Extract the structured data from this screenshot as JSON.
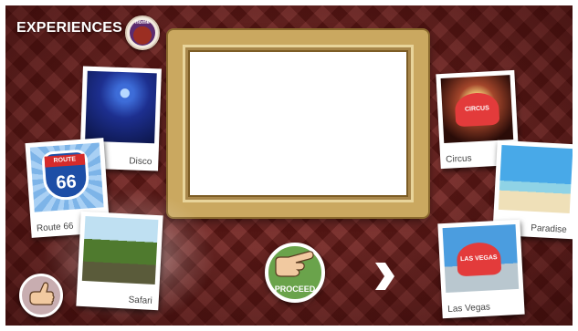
{
  "header": {
    "title": "EXPERIENCES",
    "home_label": "home"
  },
  "photos": {
    "disco": "Disco",
    "route66": "Route 66",
    "route66_sign_top": "ROUTE",
    "route66_sign_number": "66",
    "safari": "Safari",
    "circus": "Circus",
    "circus_sign": "CIRCUS",
    "paradise": "Paradise",
    "vegas": "Las Vegas",
    "vegas_sign": "LAS VEGAS"
  },
  "actions": {
    "proceed": "PROCEED"
  },
  "icons": {
    "home": "home-icon",
    "proceed": "pointing-hand-icon",
    "next": "chevron-right-icon",
    "back": "thumbs-hand-icon"
  },
  "colors": {
    "background": "#6e1d1a",
    "proceed": "#6aa34b",
    "frame": "#caa860"
  }
}
